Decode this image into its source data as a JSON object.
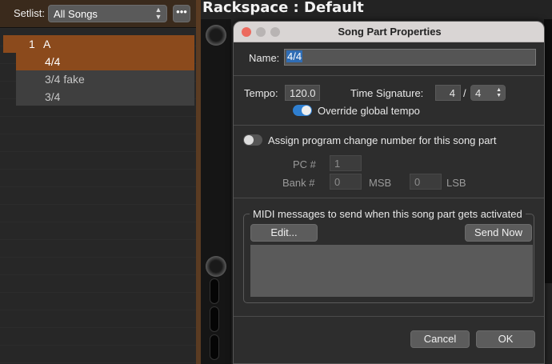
{
  "setlist": {
    "label": "Setlist:",
    "selected": "All Songs",
    "more_label": "•••",
    "songs": [
      {
        "number": "1",
        "name": "A"
      }
    ],
    "parts": [
      "4/4",
      "3/4 fake",
      "3/4"
    ],
    "selected_part_index": 0
  },
  "rackspace": {
    "title": "Rackspace : Default"
  },
  "dialog": {
    "title": "Song Part Properties",
    "name_label": "Name:",
    "name_value": "4/4",
    "tempo_label": "Tempo:",
    "tempo_value": "120.0",
    "time_signature_label": "Time Signature:",
    "ts_numerator": "4",
    "ts_slash": "/",
    "ts_denominator": "4",
    "override_label": "Override global tempo",
    "override_enabled": true,
    "assign_pc_label": "Assign program change number for this song part",
    "assign_pc_enabled": false,
    "pc_label": "PC #",
    "pc_value": "1",
    "bank_label": "Bank #",
    "msb_value": "0",
    "msb_label": "MSB",
    "lsb_value": "0",
    "lsb_label": "LSB",
    "midi_group_label": "MIDI messages to send when this song part gets activated",
    "edit_label": "Edit...",
    "send_now_label": "Send Now",
    "cancel_label": "Cancel",
    "ok_label": "OK"
  },
  "colors": {
    "accent": "#8b4a1c",
    "toggle_on": "#2f7fd0",
    "close": "#ec6a5e",
    "minimize": "#b8b4b3",
    "zoom": "#b8b4b3"
  }
}
